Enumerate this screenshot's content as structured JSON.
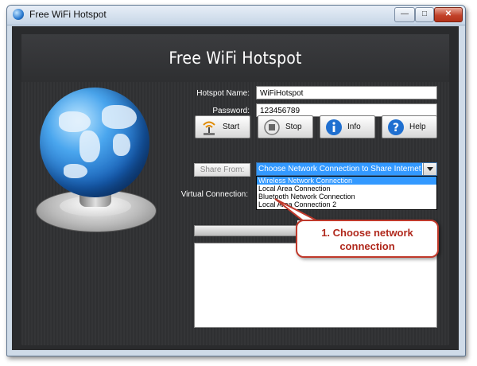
{
  "window": {
    "title": "Free WiFi Hotspot",
    "controls": {
      "minimize": "—",
      "maximize": "□",
      "close": "✕"
    }
  },
  "app": {
    "heading": "Free WiFi Hotspot",
    "hotspot_name_label": "Hotspot Name:",
    "hotspot_name_value": "WiFiHotspot",
    "password_label": "Password:",
    "password_value": "123456789",
    "buttons": {
      "start": "Start",
      "stop": "Stop",
      "info": "Info",
      "help": "Help"
    },
    "share_from_label": "Share From:",
    "share_select_value": "Choose Network Connection to Share Internet",
    "share_options": [
      "Wireless Network Connection",
      "Local Area Connection",
      "Bluetooth Network Connection",
      "Local Area Connection 2"
    ],
    "virtual_connection_label": "Virtual Connection:"
  },
  "callout": {
    "line1": "1. Choose network",
    "line2": "connection"
  },
  "icons": {
    "app": "globe-icon",
    "start": "wifi-antenna-icon",
    "stop": "stop-icon",
    "info": "info-icon",
    "help": "help-icon"
  },
  "colors": {
    "accent_blue": "#3399ff",
    "callout_red": "#c0392b",
    "panel_dark": "#2f3032"
  }
}
